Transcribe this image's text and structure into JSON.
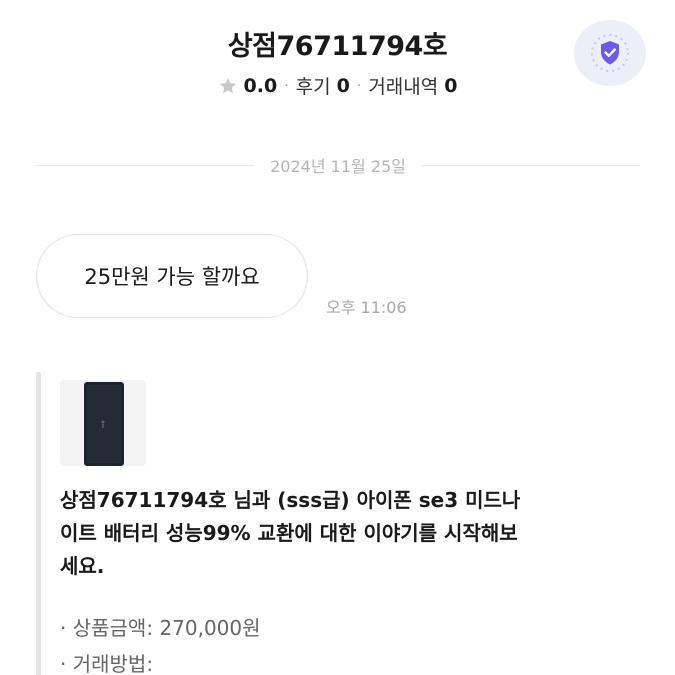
{
  "header": {
    "shop_name": "상점76711794호",
    "rating": "0.0",
    "reviews_label": "후기",
    "reviews_count": "0",
    "trades_label": "거래내역",
    "trades_count": "0",
    "separator": "·"
  },
  "icons": {
    "rating": "star-icon",
    "verify": "shield-check-icon"
  },
  "colors": {
    "accent": "#6b5be6",
    "shield_bg": "#eceef8",
    "muted": "#a8a8a8"
  },
  "chat": {
    "date": "2024년 11월 25일",
    "message": "25만원 가능 할까요",
    "time": "오후 11:06"
  },
  "product_card": {
    "title": "상점76711794호 님과 (sss급) 아이폰 se3 미드나이트 배터리 성능99% 교환에 대한 이야기를 시작해보세요.",
    "price_label": "· 상품금액: ",
    "price_value": "270,000원",
    "method_label": "· 거래방법: ",
    "method_value": ""
  }
}
